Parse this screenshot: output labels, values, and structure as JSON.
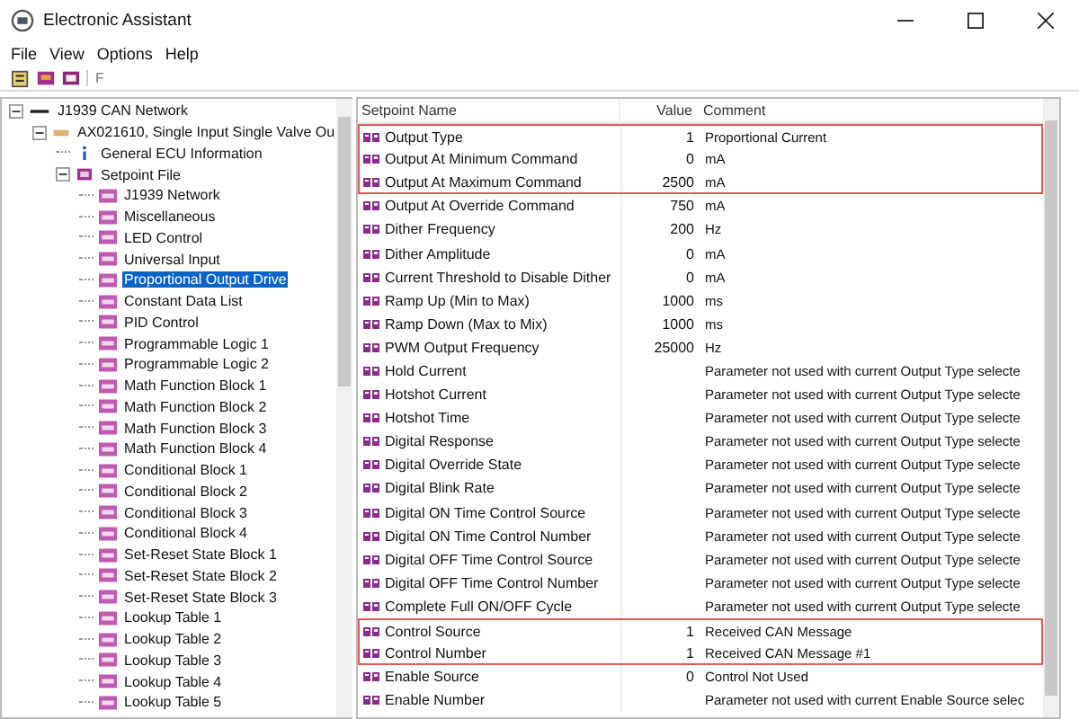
{
  "window": {
    "title": "Electronic Assistant"
  },
  "menu": [
    "File",
    "View",
    "Options",
    "Help"
  ],
  "toolbar": [
    {
      "kind": "open"
    },
    {
      "kind": "read"
    },
    {
      "kind": "write"
    },
    {
      "kind": "text",
      "label": "F"
    }
  ],
  "tree": [
    {
      "kind": "network",
      "label": "J1939 CAN Network",
      "expanded": true,
      "selected": false,
      "children": [
        {
          "kind": "ecu",
          "label": "AX021610, Single Input Single Valve Ou",
          "expanded": true,
          "selected": false,
          "children": [
            {
              "kind": "info",
              "label": "General ECU Information",
              "selected": false
            },
            {
              "kind": "folder",
              "label": "Setpoint File",
              "expanded": true,
              "selected": false,
              "children": [
                {
                  "kind": "sp",
                  "label": "J1939 Network",
                  "selected": false
                },
                {
                  "kind": "sp",
                  "label": "Miscellaneous",
                  "selected": false
                },
                {
                  "kind": "sp",
                  "label": "LED Control",
                  "selected": false
                },
                {
                  "kind": "sp",
                  "label": "Universal Input",
                  "selected": false
                },
                {
                  "kind": "sp",
                  "label": "Proportional Output Drive",
                  "selected": true
                },
                {
                  "kind": "sp",
                  "label": "Constant Data List",
                  "selected": false
                },
                {
                  "kind": "sp",
                  "label": "PID Control",
                  "selected": false
                },
                {
                  "kind": "sp",
                  "label": "Programmable Logic 1",
                  "selected": false
                },
                {
                  "kind": "sp",
                  "label": "Programmable Logic 2",
                  "selected": false
                },
                {
                  "kind": "sp",
                  "label": "Math Function Block 1",
                  "selected": false
                },
                {
                  "kind": "sp",
                  "label": "Math Function Block 2",
                  "selected": false
                },
                {
                  "kind": "sp",
                  "label": "Math Function Block 3",
                  "selected": false
                },
                {
                  "kind": "sp",
                  "label": "Math Function Block 4",
                  "selected": false
                },
                {
                  "kind": "sp",
                  "label": "Conditional Block 1",
                  "selected": false
                },
                {
                  "kind": "sp",
                  "label": "Conditional Block 2",
                  "selected": false
                },
                {
                  "kind": "sp",
                  "label": "Conditional Block 3",
                  "selected": false
                },
                {
                  "kind": "sp",
                  "label": "Conditional Block 4",
                  "selected": false
                },
                {
                  "kind": "sp",
                  "label": "Set-Reset State Block 1",
                  "selected": false
                },
                {
                  "kind": "sp",
                  "label": "Set-Reset State Block 2",
                  "selected": false
                },
                {
                  "kind": "sp",
                  "label": "Set-Reset State Block 3",
                  "selected": false
                },
                {
                  "kind": "sp",
                  "label": "Lookup Table 1",
                  "selected": false
                },
                {
                  "kind": "sp",
                  "label": "Lookup Table 2",
                  "selected": false
                },
                {
                  "kind": "sp",
                  "label": "Lookup Table 3",
                  "selected": false
                },
                {
                  "kind": "sp",
                  "label": "Lookup Table 4",
                  "selected": false
                },
                {
                  "kind": "sp",
                  "label": "Lookup Table 5",
                  "selected": false
                }
              ]
            }
          ]
        }
      ]
    }
  ],
  "table": {
    "columns": [
      "Setpoint Name",
      "Value",
      "Comment"
    ],
    "rows": [
      {
        "name": "Output Type",
        "value": "1",
        "comment": "Proportional Current",
        "highlighted": true
      },
      {
        "name": "Output At Minimum Command",
        "value": "0",
        "comment": "mA",
        "highlighted": true
      },
      {
        "name": "Output At Maximum Command",
        "value": "2500",
        "comment": "mA",
        "highlighted": true
      },
      {
        "name": "Output At Override Command",
        "value": "750",
        "comment": "mA",
        "highlighted": false
      },
      {
        "name": "Dither Frequency",
        "value": "200",
        "comment": "Hz",
        "highlighted": false
      },
      {
        "name": "Dither Amplitude",
        "value": "0",
        "comment": "mA",
        "highlighted": false
      },
      {
        "name": "Current Threshold to Disable Dither",
        "value": "0",
        "comment": "mA",
        "highlighted": false
      },
      {
        "name": "Ramp Up (Min to Max)",
        "value": "1000",
        "comment": "ms",
        "highlighted": false
      },
      {
        "name": "Ramp Down (Max to Mix)",
        "value": "1000",
        "comment": "ms",
        "highlighted": false
      },
      {
        "name": "PWM Output Frequency",
        "value": "25000",
        "comment": "Hz",
        "highlighted": false
      },
      {
        "name": "Hold Current",
        "comment": "Parameter not used with current Output Type selecte",
        "highlighted": false
      },
      {
        "name": "Hotshot Current",
        "comment": "Parameter not used with current Output Type selecte",
        "highlighted": false
      },
      {
        "name": "Hotshot Time",
        "comment": "Parameter not used with current Output Type selecte",
        "highlighted": false
      },
      {
        "name": "Digital Response",
        "comment": "Parameter not used with current Output Type selecte",
        "highlighted": false
      },
      {
        "name": "Digital Override State",
        "comment": "Parameter not used with current Output Type selecte",
        "highlighted": false
      },
      {
        "name": "Digital Blink Rate",
        "comment": "Parameter not used with current Output Type selecte",
        "highlighted": false
      },
      {
        "name": "Digital ON Time Control Source",
        "comment": "Parameter not used with current Output Type selecte",
        "highlighted": false
      },
      {
        "name": "Digital ON Time Control Number",
        "comment": "Parameter not used with current Output Type selecte",
        "highlighted": false
      },
      {
        "name": "Digital OFF Time Control Source",
        "comment": "Parameter not used with current Output Type selecte",
        "highlighted": false
      },
      {
        "name": "Digital OFF Time Control Number",
        "comment": "Parameter not used with current Output Type selecte",
        "highlighted": false
      },
      {
        "name": "Complete Full ON/OFF Cycle",
        "comment": "Parameter not used with current Output Type selecte",
        "highlighted": false
      },
      {
        "name": "Control Source",
        "value": "1",
        "comment": "Received CAN Message",
        "highlighted": true
      },
      {
        "name": "Control Number",
        "value": "1",
        "comment": "Received CAN Message #1",
        "highlighted": true
      },
      {
        "name": "Enable Source",
        "value": "0",
        "comment": "Control Not Used",
        "highlighted": false
      },
      {
        "name": "Enable Number",
        "comment": "Parameter not used with current Enable Source selec",
        "highlighted": false
      }
    ]
  }
}
